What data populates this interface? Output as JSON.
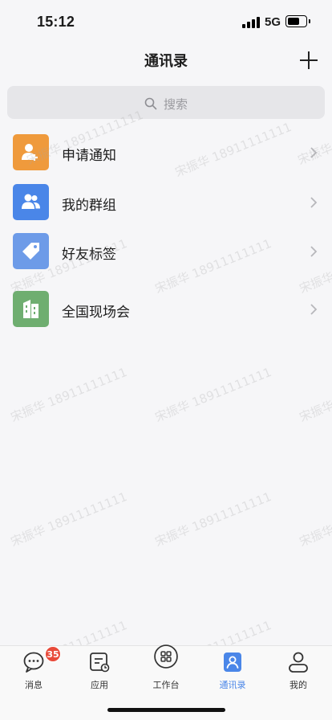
{
  "status_bar": {
    "time": "15:12",
    "network": "5G",
    "battery_level": 0.7
  },
  "header": {
    "title": "通讯录",
    "add_icon": "plus-icon"
  },
  "search": {
    "placeholder": "搜索",
    "icon": "search-icon"
  },
  "menu": [
    {
      "label": "申请通知",
      "icon": "user-add-icon",
      "color": "#ef9a3c"
    },
    {
      "label": "我的群组",
      "icon": "group-icon",
      "color": "#4a86e8"
    },
    {
      "label": "好友标签",
      "icon": "tag-icon",
      "color": "#6d9be8"
    },
    {
      "label": "全国现场会",
      "icon": "building-icon",
      "color": "#6fae70"
    }
  ],
  "watermark": {
    "text": "宋振华 18911111111"
  },
  "tabs": [
    {
      "label": "消息",
      "icon": "message-icon",
      "badge": "35"
    },
    {
      "label": "应用",
      "icon": "app-icon"
    },
    {
      "label": "工作台",
      "icon": "workbench-icon"
    },
    {
      "label": "通讯录",
      "icon": "contacts-icon",
      "active": true
    },
    {
      "label": "我的",
      "icon": "profile-icon"
    }
  ],
  "colors": {
    "accent": "#4a86e8",
    "badge": "#e84a3a"
  }
}
